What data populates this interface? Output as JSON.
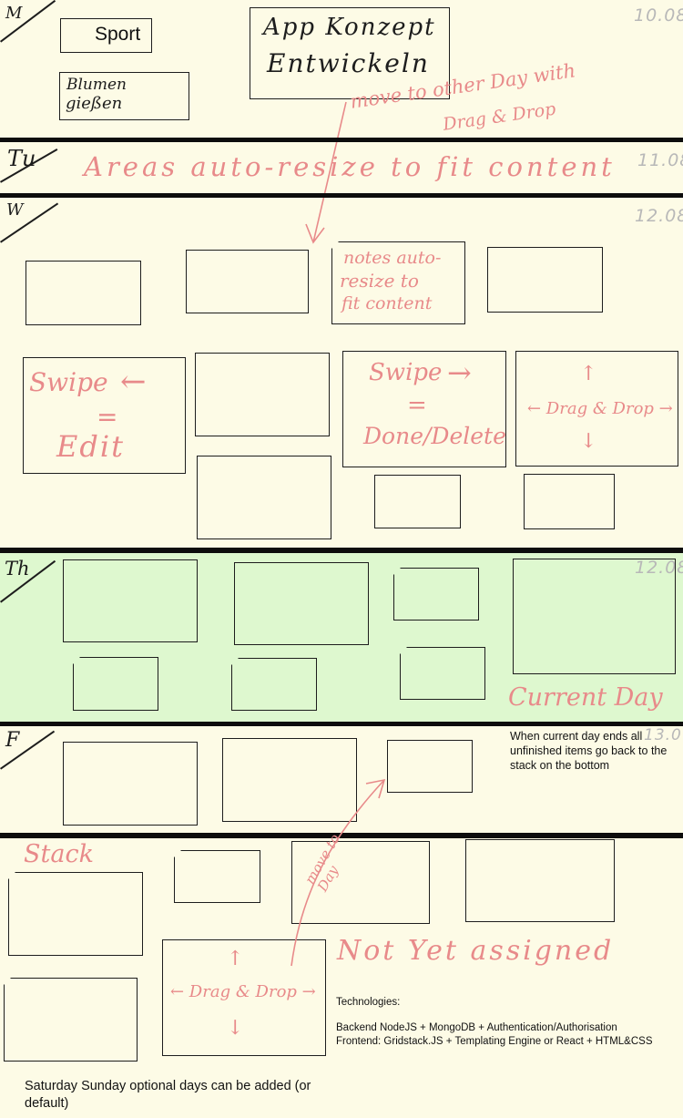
{
  "days": {
    "mon": {
      "label": "M",
      "date": "10.08"
    },
    "tue": {
      "label": "Tu",
      "date": "11.08"
    },
    "wed": {
      "label": "W",
      "date": "12.08"
    },
    "thu": {
      "label": "Th",
      "date": "12.08"
    },
    "fri": {
      "label": "F",
      "date": "13.0"
    }
  },
  "mon_notes": {
    "sport": "Sport",
    "blumen_line1": "Blumen",
    "blumen_line2": "gießen",
    "app_line1": "App Konzept",
    "app_line2": "Entwickeln"
  },
  "annotations": {
    "move_other_day_line1": "move to other Day with",
    "move_other_day_line2": "Drag & Drop",
    "areas_resize": "Areas auto-resize to fit content",
    "notes_resize_line1": "notes auto-",
    "notes_resize_line2": "resize to",
    "notes_resize_line3": "fit content",
    "swipe_left_title": "Swipe",
    "swipe_left_arrow": "←",
    "swipe_left_eq": "=",
    "swipe_left_result": "Edit",
    "swipe_right_title": "Swipe",
    "swipe_right_arrow": "→",
    "swipe_right_eq": "=",
    "swipe_right_result": "Done/Delete",
    "drag_drop_1": "← Drag & Drop →",
    "drag_drop_arrow_up_1": "↑",
    "drag_drop_arrow_down_1": "↓",
    "current_day": "Current Day",
    "current_day_note": "When current day ends all unfinished items go back to the stack on the bottom",
    "stack_label": "Stack",
    "move_to_day": "move to Day",
    "not_yet_assigned": "Not Yet assigned",
    "drag_drop_2": "← Drag & Drop →",
    "drag_drop_arrow_up_2": "↑",
    "drag_drop_arrow_down_2": "↓"
  },
  "technologies": {
    "heading": "Technologies:",
    "backend": "Backend NodeJS + MongoDB + Authentication/Authorisation",
    "frontend": "Frontend: Gridstack.JS + Templating Engine or React + HTML&CSS"
  },
  "footer_note": "Saturday Sunday optional days can be added (or default)",
  "colors": {
    "background": "#fdfbe6",
    "current_day_band": "#def8cf",
    "handwriting_red": "#e88a8a",
    "ink": "#1d1d1d",
    "date_grey": "#b8b8b8"
  }
}
